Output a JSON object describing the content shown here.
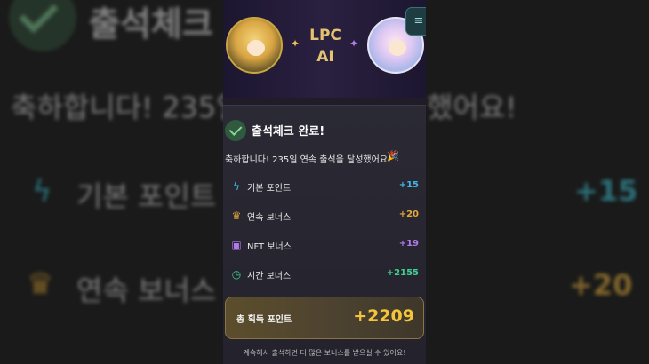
{
  "brand": {
    "name_line1": "LPC",
    "name_line2": "AI"
  },
  "header": {
    "menu_icon": "hamburger-icon",
    "avatar_left": "fox-girl-avatar",
    "avatar_right": "anime-girl-avatar"
  },
  "checkin": {
    "title": "출석체크 완료!",
    "congrats": "축하합니다! 235일 연속 출석을 달성했어요!",
    "streak_days": 235
  },
  "points": [
    {
      "label": "기본 포인트",
      "value": "+15",
      "icon": "lightning-icon",
      "color": "#41b6e6"
    },
    {
      "label": "연속 보너스",
      "value": "+20",
      "icon": "trophy-icon",
      "color": "#e0a93a"
    },
    {
      "label": "NFT 보너스",
      "value": "+19",
      "icon": "gift-icon",
      "color": "#b07ae8"
    },
    {
      "label": "시간 보너스",
      "value": "+2155",
      "icon": "clock-icon",
      "color": "#3fd08f"
    }
  ],
  "total": {
    "label": "총 획득 포인트",
    "value": "+2209"
  },
  "footer": "계속해서 출석하면 더 많은 보너스를 받으실 수 있어요!",
  "background": {
    "title": "출석체크",
    "congrats_left": "축하합니다! 235일",
    "congrats_right": "했어요!",
    "row1_label": "기본 포인트",
    "row1_value": "+15",
    "row2_label": "연속 보너스",
    "row2_value": "+20"
  }
}
